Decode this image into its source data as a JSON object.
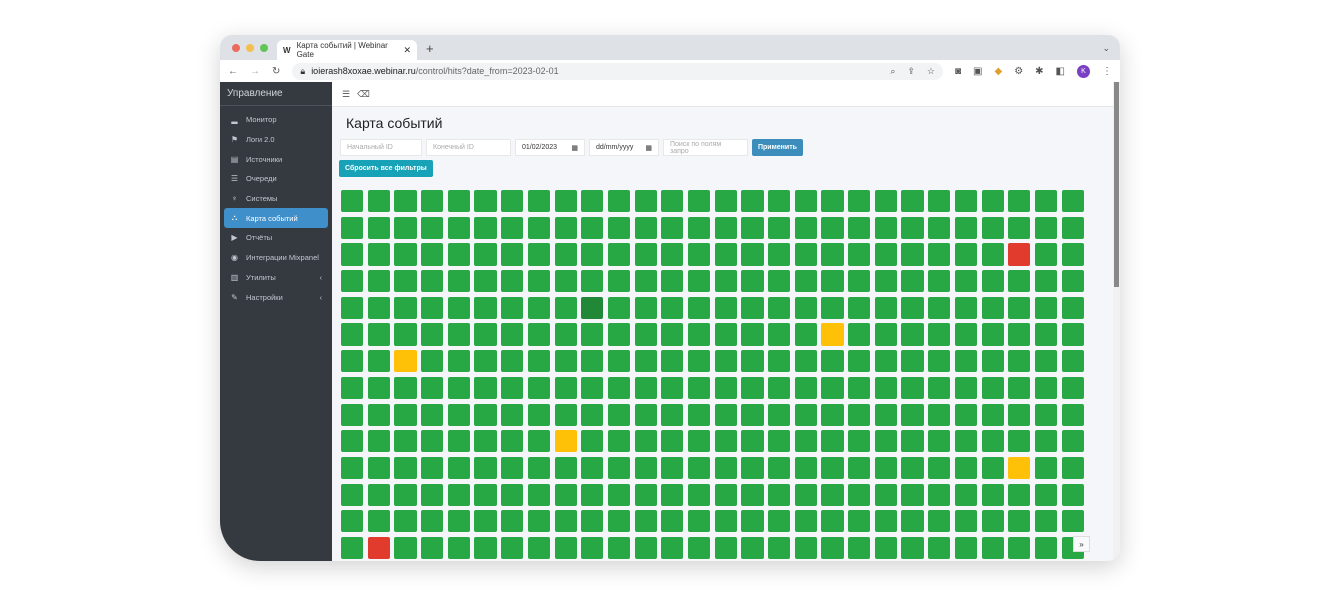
{
  "browser": {
    "tab_title": "Карта событий | Webinar Gate",
    "tab_favicon": "W",
    "url_host": "ioierash8xoxae.webinar.ru",
    "url_path": "/control/hits?date_from=2023-02-01",
    "profile_initial": "K",
    "colors": {
      "close": "#ed6a5e",
      "minimize": "#f5bf4f",
      "maximize": "#61c554"
    }
  },
  "sidebar": {
    "brand": "Управление",
    "items": [
      {
        "label": "Монитор",
        "icon": "signal-icon"
      },
      {
        "label": "Логи 2.0",
        "icon": "flag-icon"
      },
      {
        "label": "Источники",
        "icon": "id-card-icon"
      },
      {
        "label": "Очереди",
        "icon": "list-icon"
      },
      {
        "label": "Системы",
        "icon": "plug-icon"
      },
      {
        "label": "Карта событий",
        "icon": "share-nodes-icon",
        "active": true
      },
      {
        "label": "Отчёты",
        "icon": "file-export-icon"
      },
      {
        "label": "Интеграции Mixpanel",
        "icon": "circle-dot-icon"
      },
      {
        "label": "Утилиты",
        "icon": "toolbox-icon",
        "has_submenu": true
      },
      {
        "label": "Настройки",
        "icon": "wrench-icon",
        "has_submenu": true
      }
    ]
  },
  "page": {
    "title": "Карта событий"
  },
  "filters": {
    "start_id_placeholder": "Начальный ID",
    "end_id_placeholder": "Конечный ID",
    "date_from": "01/02/2023",
    "date_to_placeholder": "dd/mm/yyyy",
    "search_placeholder": "Поиск по полям запро",
    "apply_label": "Применить",
    "reset_label": "Сбросить все фильтры"
  },
  "event_map": {
    "columns": 28,
    "rows": 14,
    "default_status": "ok",
    "status_colors": {
      "ok": "#28a745",
      "selected": "#218838",
      "warning": "#ffc107",
      "error": "#e03b2c"
    },
    "exceptions": [
      {
        "row": 2,
        "col": 25,
        "status": "error"
      },
      {
        "row": 4,
        "col": 9,
        "status": "selected"
      },
      {
        "row": 5,
        "col": 18,
        "status": "warning"
      },
      {
        "row": 6,
        "col": 2,
        "status": "warning"
      },
      {
        "row": 9,
        "col": 8,
        "status": "warning"
      },
      {
        "row": 10,
        "col": 25,
        "status": "warning"
      },
      {
        "row": 13,
        "col": 1,
        "status": "error"
      }
    ]
  }
}
